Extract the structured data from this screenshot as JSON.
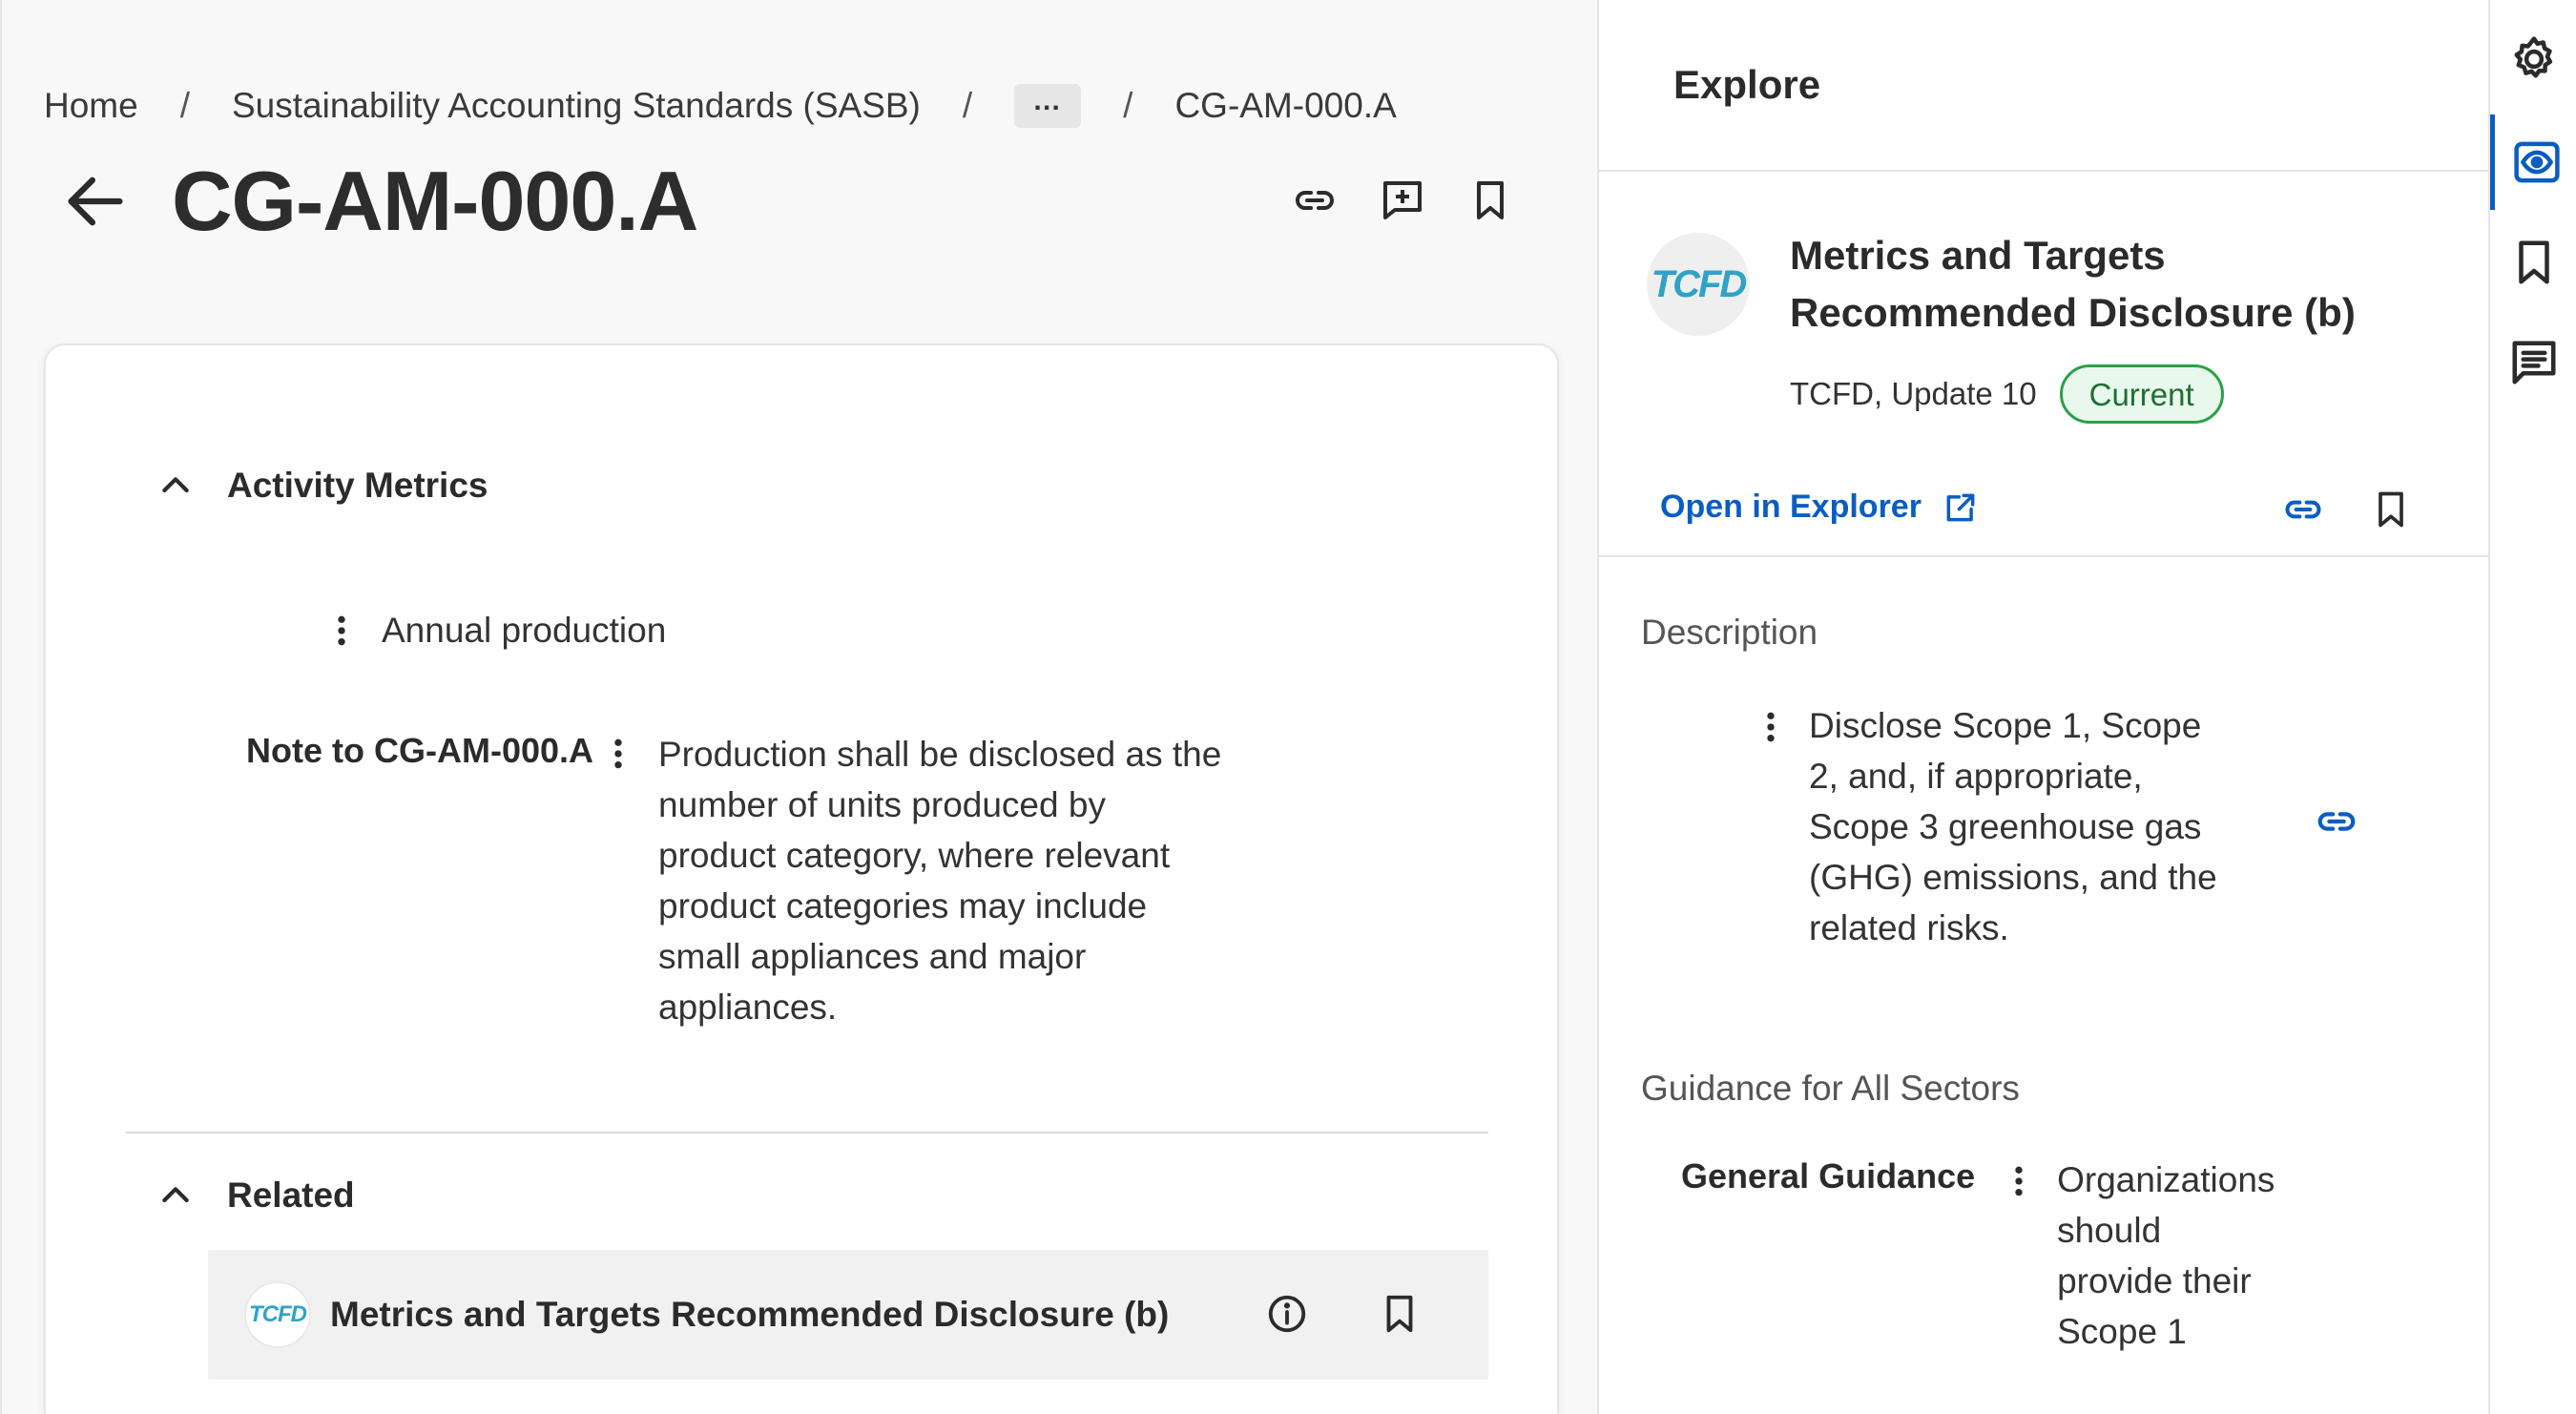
{
  "breadcrumb": {
    "home": "Home",
    "sasb": "Sustainability Accounting Standards (SASB)",
    "ellipsis": "…",
    "current": "CG-AM-000.A",
    "separator": "/"
  },
  "page": {
    "title": "CG-AM-000.A"
  },
  "activity_metrics": {
    "heading": "Activity Metrics",
    "item": "Annual production",
    "note_label": "Note to CG-AM-000.A",
    "note_text": "Production shall be disclosed as the number of units produced by product category, where relevant product categories may include small appliances and major appliances."
  },
  "related": {
    "heading": "Related",
    "badge": "TCFD",
    "item_title": "Metrics and Targets Recommended Disclosure (b)"
  },
  "panel": {
    "header": "Explore",
    "badge": "TCFD",
    "title": "Metrics and Targets Recommended Disclosure (b)",
    "meta": "TCFD, Update 10",
    "status": "Current",
    "open_link": "Open in Explorer",
    "description_label": "Description",
    "description": "Disclose Scope 1, Scope 2, and, if appropriate, Scope 3 greenhouse gas (GHG) emissions, and the related risks.",
    "guidance_label": "Guidance for All Sectors",
    "general_guidance_label": "General Guidance",
    "general_guidance_text": "Organizations should provide their Scope 1"
  },
  "icons": {
    "back": "arrow-left-icon",
    "link": "link-icon",
    "add_comment": "add-comment-icon",
    "bookmark": "bookmark-icon",
    "info": "info-icon",
    "external": "external-link-icon",
    "settings": "gear-icon",
    "view": "eye-icon",
    "comments": "comment-list-icon"
  },
  "colors": {
    "accent": "#0a5dc2",
    "status_border": "#2aa148",
    "status_bg": "#e9f8ec",
    "tcfd_brand": "#2ea3c8"
  }
}
